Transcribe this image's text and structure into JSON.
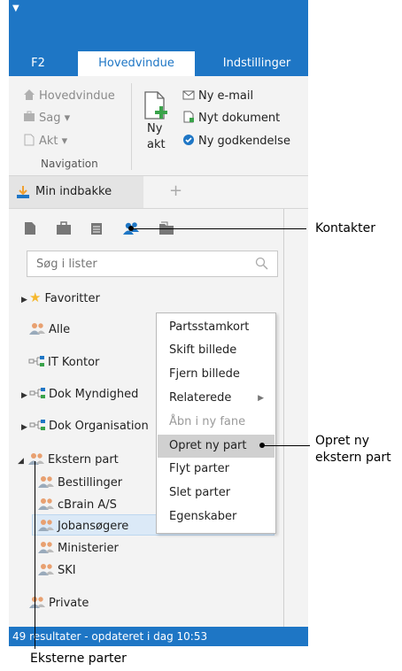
{
  "quick_access_arrow": "▼",
  "tabs": {
    "f2": "F2",
    "hovedvindue": "Hovedvindue",
    "indstillinger": "Indstillinger"
  },
  "ribbon": {
    "hovedvindue": "Hovedvindue",
    "sag": "Sag ▾",
    "akt": "Akt ▾",
    "ny_akt_line1": "Ny",
    "ny_akt_line2": "akt",
    "ny_email": "Ny e-mail",
    "nyt_dokument": "Nyt dokument",
    "ny_godkendelse": "Ny godkendelse",
    "navigation": "Navigation"
  },
  "inbox_tab": {
    "label": "Min indbakke",
    "add": "+"
  },
  "search": {
    "placeholder": "Søg i lister"
  },
  "tree": {
    "favoritter": "Favoritter",
    "alle": "Alle",
    "it_kontor": "IT Kontor",
    "dok_myndighed": "Dok Myndighed",
    "dok_organisation": "Dok Organisation",
    "ekstern_part": "Ekstern part",
    "bestillinger": "Bestillinger",
    "cbrain": "cBrain A/S",
    "jobansogere": "Jobansøgere",
    "ministerier": "Ministerier",
    "ski": "SKI",
    "private": "Private"
  },
  "context_menu": {
    "partsstamkort": "Partsstamkort",
    "skift_billede": "Skift billede",
    "fjern_billede": "Fjern billede",
    "relaterede": "Relaterede",
    "aabn_ny_fane": "Åbn i ny fane",
    "opret_ny_part": "Opret ny part",
    "flyt_parter": "Flyt parter",
    "slet_parter": "Slet parter",
    "egenskaber": "Egenskaber"
  },
  "status": "49 resultater - opdateret i dag 10:53",
  "callouts": {
    "kontakter": "Kontakter",
    "opret_ny_line1": "Opret ny",
    "opret_ny_line2": "ekstern part",
    "eksterne_parter": "Eksterne parter"
  },
  "colors": {
    "accent": "#1e76c5",
    "contact_icon": "#1e76c5",
    "star": "#f5b82e",
    "hover": "#d0d0d0"
  }
}
